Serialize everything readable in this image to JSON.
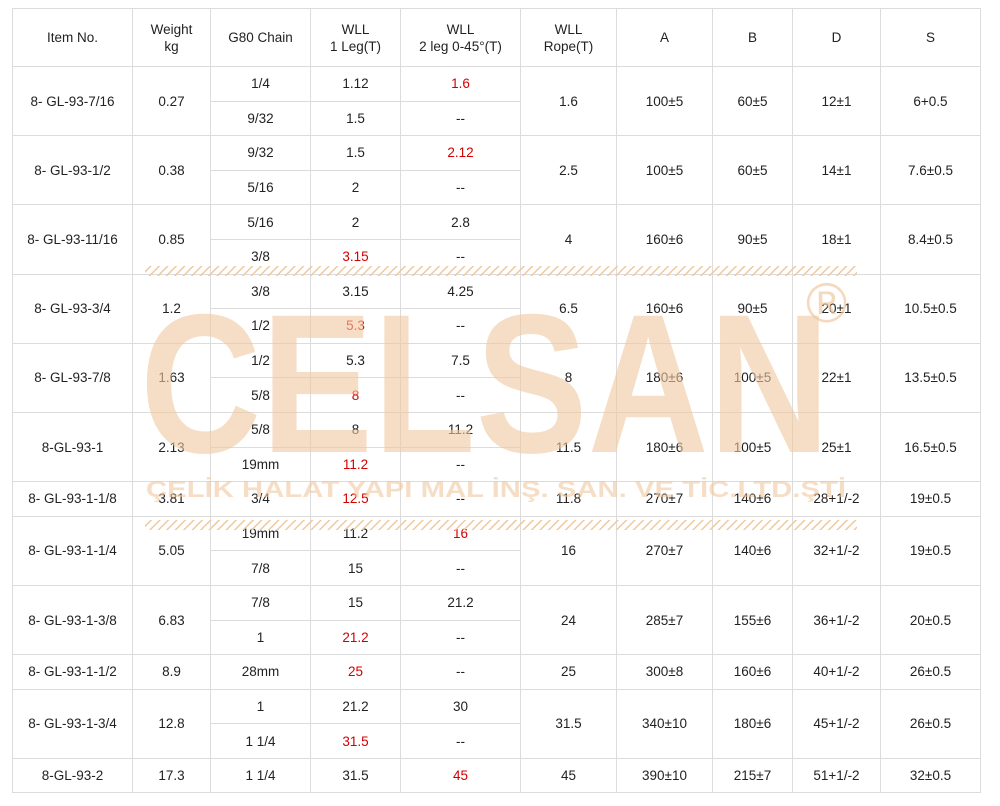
{
  "table": {
    "headers": [
      {
        "line1": "Item No.",
        "line2": ""
      },
      {
        "line1": "Weight",
        "line2": "kg"
      },
      {
        "line1": "G80 Chain",
        "line2": ""
      },
      {
        "line1": "WLL",
        "line2": "1 Leg(T)"
      },
      {
        "line1": "WLL",
        "line2": "2 leg 0-45°(T)"
      },
      {
        "line1": "WLL",
        "line2": "Rope(T)"
      },
      {
        "line1": "A",
        "line2": ""
      },
      {
        "line1": "B",
        "line2": ""
      },
      {
        "line1": "D",
        "line2": ""
      },
      {
        "line1": "S",
        "line2": ""
      }
    ],
    "items": [
      {
        "item": "8- GL-93-7/16",
        "weight": "0.27",
        "rope": "1.6",
        "a": "100±5",
        "b": "60±5",
        "d": "12±1",
        "s": "6+0.5",
        "subrows": [
          {
            "chain": "1/4",
            "leg1": "1.12",
            "leg1_red": false,
            "leg2": "1.6",
            "leg2_red": true
          },
          {
            "chain": "9/32",
            "leg1": "1.5",
            "leg1_red": false,
            "leg2": "--",
            "leg2_red": false
          }
        ]
      },
      {
        "item": "8- GL-93-1/2",
        "weight": "0.38",
        "rope": "2.5",
        "a": "100±5",
        "b": "60±5",
        "d": "14±1",
        "s": "7.6±0.5",
        "subrows": [
          {
            "chain": "9/32",
            "leg1": "1.5",
            "leg1_red": false,
            "leg2": "2.12",
            "leg2_red": true
          },
          {
            "chain": "5/16",
            "leg1": "2",
            "leg1_red": false,
            "leg2": "--",
            "leg2_red": false
          }
        ]
      },
      {
        "item": "8- GL-93-11/16",
        "weight": "0.85",
        "rope": "4",
        "a": "160±6",
        "b": "90±5",
        "d": "18±1",
        "s": "8.4±0.5",
        "subrows": [
          {
            "chain": "5/16",
            "leg1": "2",
            "leg1_red": false,
            "leg2": "2.8",
            "leg2_red": false
          },
          {
            "chain": "3/8",
            "leg1": "3.15",
            "leg1_red": true,
            "leg2": "--",
            "leg2_red": false
          }
        ]
      },
      {
        "item": "8- GL-93-3/4",
        "weight": "1.2",
        "rope": "6.5",
        "a": "160±6",
        "b": "90±5",
        "d": "20±1",
        "s": "10.5±0.5",
        "subrows": [
          {
            "chain": "3/8",
            "leg1": "3.15",
            "leg1_red": false,
            "leg2": "4.25",
            "leg2_red": false
          },
          {
            "chain": "1/2",
            "leg1": "5.3",
            "leg1_red": true,
            "leg2": "--",
            "leg2_red": false
          }
        ]
      },
      {
        "item": "8- GL-93-7/8",
        "weight": "1.63",
        "rope": "8",
        "a": "180±6",
        "b": "100±5",
        "d": "22±1",
        "s": "13.5±0.5",
        "subrows": [
          {
            "chain": "1/2",
            "leg1": "5.3",
            "leg1_red": false,
            "leg2": "7.5",
            "leg2_red": false
          },
          {
            "chain": "5/8",
            "leg1": "8",
            "leg1_red": true,
            "leg2": "--",
            "leg2_red": false
          }
        ]
      },
      {
        "item": "8-GL-93-1",
        "weight": "2.13",
        "rope": "11.5",
        "a": "180±6",
        "b": "100±5",
        "d": "25±1",
        "s": "16.5±0.5",
        "subrows": [
          {
            "chain": "5/8",
            "leg1": "8",
            "leg1_red": false,
            "leg2": "11.2",
            "leg2_red": false
          },
          {
            "chain": "19mm",
            "leg1": "11.2",
            "leg1_red": true,
            "leg2": "--",
            "leg2_red": false
          }
        ]
      },
      {
        "item": "8- GL-93-1-1/8",
        "weight": "3.81",
        "rope": "11.8",
        "a": "270±7",
        "b": "140±6",
        "d": "28+1/-2",
        "s": "19±0.5",
        "subrows": [
          {
            "chain": "3/4",
            "leg1": "12.5",
            "leg1_red": true,
            "leg2": "--",
            "leg2_red": false
          }
        ]
      },
      {
        "item": "8- GL-93-1-1/4",
        "weight": "5.05",
        "rope": "16",
        "a": "270±7",
        "b": "140±6",
        "d": "32+1/-2",
        "s": "19±0.5",
        "subrows": [
          {
            "chain": "19mm",
            "leg1": "11.2",
            "leg1_red": false,
            "leg2": "16",
            "leg2_red": true
          },
          {
            "chain": "7/8",
            "leg1": "15",
            "leg1_red": false,
            "leg2": "--",
            "leg2_red": false
          }
        ]
      },
      {
        "item": "8- GL-93-1-3/8",
        "weight": "6.83",
        "rope": "24",
        "a": "285±7",
        "b": "155±6",
        "d": "36+1/-2",
        "s": "20±0.5",
        "subrows": [
          {
            "chain": "7/8",
            "leg1": "15",
            "leg1_red": false,
            "leg2": "21.2",
            "leg2_red": false
          },
          {
            "chain": "1",
            "leg1": "21.2",
            "leg1_red": true,
            "leg2": "--",
            "leg2_red": false
          }
        ]
      },
      {
        "item": "8- GL-93-1-1/2",
        "weight": "8.9",
        "rope": "25",
        "a": "300±8",
        "b": "160±6",
        "d": "40+1/-2",
        "s": "26±0.5",
        "subrows": [
          {
            "chain": "28mm",
            "leg1": "25",
            "leg1_red": true,
            "leg2": "--",
            "leg2_red": false
          }
        ]
      },
      {
        "item": "8- GL-93-1-3/4",
        "weight": "12.8",
        "rope": "31.5",
        "a": "340±10",
        "b": "180±6",
        "d": "45+1/-2",
        "s": "26±0.5",
        "subrows": [
          {
            "chain": "1",
            "leg1": "21.2",
            "leg1_red": false,
            "leg2": "30",
            "leg2_red": false
          },
          {
            "chain": "1 1/4",
            "leg1": "31.5",
            "leg1_red": true,
            "leg2": "--",
            "leg2_red": false
          }
        ]
      },
      {
        "item": "8-GL-93-2",
        "weight": "17.3",
        "rope": "45",
        "a": "390±10",
        "b": "215±7",
        "d": "51+1/-2",
        "s": "32±0.5",
        "subrows": [
          {
            "chain": "1 1/4",
            "leg1": "31.5",
            "leg1_red": false,
            "leg2": "45",
            "leg2_red": true
          }
        ]
      }
    ]
  },
  "watermark": {
    "logo_text": "CELSAN",
    "registered_mark": "®",
    "company_line": "ÇELİK HALAT YAPI MAL İNŞ. SAN. VE TİC.LTD.ŞTİ",
    "color": "#f0c9a0"
  },
  "colors": {
    "highlight_red": "#d40000",
    "border": "#dcdcdc",
    "text": "#222222"
  }
}
